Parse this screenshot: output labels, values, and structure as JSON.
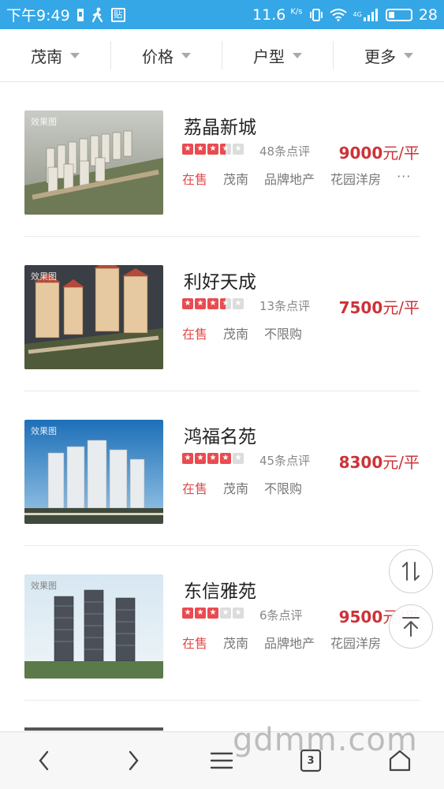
{
  "status_bar": {
    "time": "下午9:49",
    "notif_badge": "贴",
    "speed": "11.6",
    "speed_unit": "K/s",
    "network": "4G",
    "battery": "28"
  },
  "filters": [
    {
      "label": "茂南"
    },
    {
      "label": "价格"
    },
    {
      "label": "户型"
    },
    {
      "label": "更多"
    }
  ],
  "listings": [
    {
      "name": "荔晶新城",
      "rating": 3.5,
      "reviews": "48条点评",
      "price": "9000",
      "price_unit": "元/平",
      "tags": [
        "在售",
        "茂南",
        "品牌地产",
        "花园洋房"
      ],
      "more": "···"
    },
    {
      "name": "利好天成",
      "rating": 3.5,
      "reviews": "13条点评",
      "price": "7500",
      "price_unit": "元/平",
      "tags": [
        "在售",
        "茂南",
        "不限购"
      ],
      "more": ""
    },
    {
      "name": "鸿福名苑",
      "rating": 4,
      "reviews": "45条点评",
      "price": "8300",
      "price_unit": "元/平",
      "tags": [
        "在售",
        "茂南",
        "不限购"
      ],
      "more": ""
    },
    {
      "name": "东信雅苑",
      "rating": 3,
      "reviews": "6条点评",
      "price": "9500",
      "price_unit": "元/平",
      "tags": [
        "在售",
        "茂南",
        "品牌地产",
        "花园洋房"
      ],
      "more": ""
    }
  ],
  "thumb_badge": "效果图",
  "bottom_nav": {
    "tabs_count": "3",
    "watermark": "gdmm.com"
  },
  "icons": {
    "back": "chevron-left-icon",
    "forward": "chevron-right-icon",
    "menu": "menu-icon",
    "tabs": "tabs-icon",
    "home": "home-icon",
    "sort": "sort-icon",
    "top": "back-to-top-icon"
  },
  "colors": {
    "accent": "#35a7e6",
    "price": "#cc3338",
    "on_sale": "#e44b4b"
  }
}
